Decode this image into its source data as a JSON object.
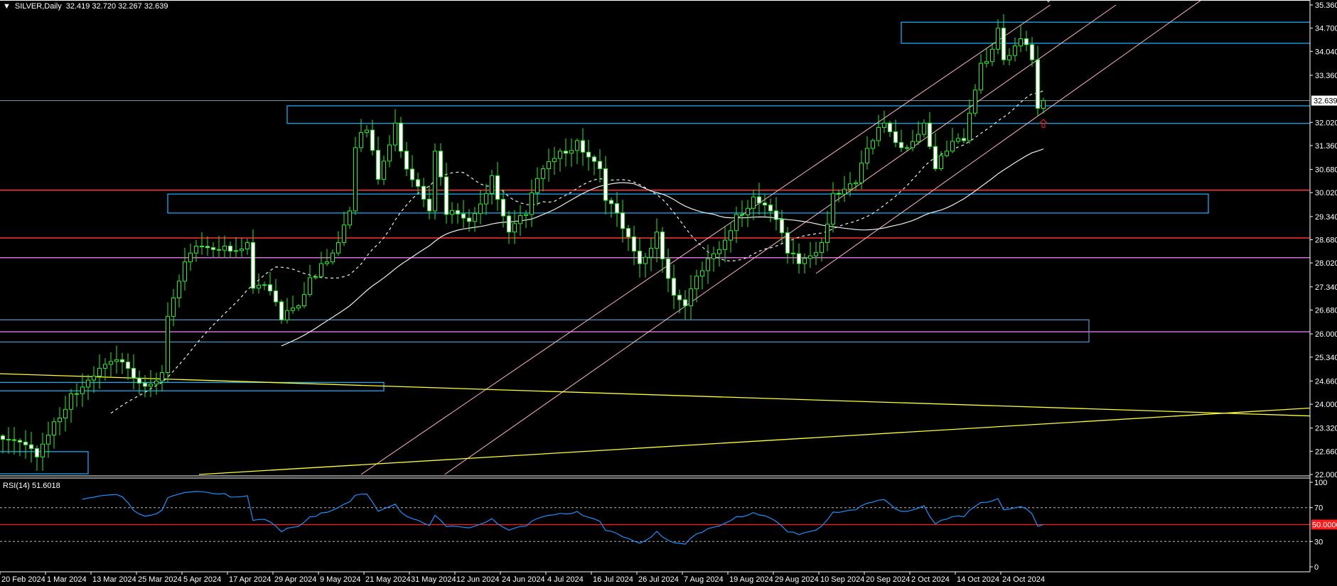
{
  "header": {
    "symbol": "SILVER,Daily",
    "ohlc": "32.419 32.720 32.267 32.639",
    "menu_icon": "triangle-down-icon"
  },
  "rsi": {
    "label": "RSI(14) 51.6018",
    "current_label": "50.0000",
    "levels": [
      70,
      50,
      30
    ],
    "axis_labels": [
      "100",
      "70",
      "30",
      "0"
    ],
    "line_color": "#1e90ff"
  },
  "colors": {
    "background": "#000000",
    "candle_border": "#22ee22",
    "bull_fill": "#000000",
    "bear_fill": "#ffffff",
    "zone": "#19a9f0",
    "zone_dim": "#4a8fc0",
    "red_level": "#ff3030",
    "violet_level": "#d070d0",
    "channel": "#ffb6c1",
    "trend": "#ffff33",
    "current_line": "#8899aa"
  },
  "chart_data": {
    "type": "candlestick",
    "title": "SILVER,Daily",
    "ylim": [
      22.0,
      35.36
    ],
    "current_price": "32.639",
    "last_bar": {
      "open": 32.419,
      "high": 32.72,
      "low": 32.267,
      "close": 32.639
    },
    "price_axis_labels": [
      "35.360",
      "34.700",
      "34.040",
      "33.360",
      "32.020",
      "31.360",
      "30.680",
      "30.020",
      "29.340",
      "28.680",
      "28.020",
      "27.340",
      "26.680",
      "26.000",
      "25.340",
      "24.660",
      "24.000",
      "23.320",
      "22.660",
      "22.000"
    ],
    "date_ticks": [
      {
        "bar": 0,
        "label": "20 Feb 2024"
      },
      {
        "bar": 8,
        "label": "1 Mar 2024"
      },
      {
        "bar": 16,
        "label": "13 Mar 2024"
      },
      {
        "bar": 24,
        "label": "25 Mar 2024"
      },
      {
        "bar": 32,
        "label": "5 Apr 2024"
      },
      {
        "bar": 40,
        "label": "17 Apr 2024"
      },
      {
        "bar": 48,
        "label": "29 Apr 2024"
      },
      {
        "bar": 56,
        "label": "9 May 2024"
      },
      {
        "bar": 64,
        "label": "21 May 2024"
      },
      {
        "bar": 72,
        "label": "31 May 2024"
      },
      {
        "bar": 80,
        "label": "12 Jun 2024"
      },
      {
        "bar": 88,
        "label": "24 Jun 2024"
      },
      {
        "bar": 96,
        "label": "4 Jul 2024"
      },
      {
        "bar": 104,
        "label": "16 Jul 2024"
      },
      {
        "bar": 112,
        "label": "26 Jul 2024"
      },
      {
        "bar": 120,
        "label": "7 Aug 2024"
      },
      {
        "bar": 128,
        "label": "19 Aug 2024"
      },
      {
        "bar": 136,
        "label": "29 Aug 2024"
      },
      {
        "bar": 144,
        "label": "10 Sep 2024"
      },
      {
        "bar": 152,
        "label": "20 Sep 2024"
      },
      {
        "bar": 160,
        "label": "2 Oct 2024"
      },
      {
        "bar": 168,
        "label": "14 Oct 2024"
      },
      {
        "bar": 176,
        "label": "24 Oct 2024"
      }
    ],
    "close_keypoints": [
      [
        0,
        23.0
      ],
      [
        6,
        22.5
      ],
      [
        9,
        23.5
      ],
      [
        12,
        24.3
      ],
      [
        16,
        24.8
      ],
      [
        21,
        25.2
      ],
      [
        24,
        24.6
      ],
      [
        28,
        24.9
      ],
      [
        29,
        26.5
      ],
      [
        31,
        27.5
      ],
      [
        33,
        28.3
      ],
      [
        37,
        28.4
      ],
      [
        39,
        28.5
      ],
      [
        43,
        28.6
      ],
      [
        44,
        27.3
      ],
      [
        46,
        27.4
      ],
      [
        49,
        26.4
      ],
      [
        52,
        26.8
      ],
      [
        54,
        27.6
      ],
      [
        56,
        28.0
      ],
      [
        59,
        28.6
      ],
      [
        61,
        29.5
      ],
      [
        62,
        31.3
      ],
      [
        64,
        31.8
      ],
      [
        66,
        30.4
      ],
      [
        69,
        32.0
      ],
      [
        70,
        31.2
      ],
      [
        73,
        30.2
      ],
      [
        75,
        29.5
      ],
      [
        76,
        31.2
      ],
      [
        78,
        29.4
      ],
      [
        82,
        29.2
      ],
      [
        86,
        30.5
      ],
      [
        89,
        28.9
      ],
      [
        92,
        29.4
      ],
      [
        95,
        30.7
      ],
      [
        98,
        31.2
      ],
      [
        101,
        31.5
      ],
      [
        105,
        30.7
      ],
      [
        106,
        29.8
      ],
      [
        109,
        29.0
      ],
      [
        112,
        28.0
      ],
      [
        115,
        28.9
      ],
      [
        118,
        27.1
      ],
      [
        120,
        26.8
      ],
      [
        123,
        27.8
      ],
      [
        126,
        28.4
      ],
      [
        129,
        29.4
      ],
      [
        132,
        29.9
      ],
      [
        135,
        29.5
      ],
      [
        138,
        28.3
      ],
      [
        140,
        28.0
      ],
      [
        144,
        28.6
      ],
      [
        146,
        30.0
      ],
      [
        150,
        30.3
      ],
      [
        153,
        31.5
      ],
      [
        155,
        32.0
      ],
      [
        158,
        31.3
      ],
      [
        162,
        32.0
      ],
      [
        164,
        30.7
      ],
      [
        166,
        31.2
      ],
      [
        169,
        31.5
      ],
      [
        172,
        33.7
      ],
      [
        174,
        34.1
      ],
      [
        175,
        34.7
      ],
      [
        176,
        33.8
      ],
      [
        179,
        34.4
      ],
      [
        181,
        33.8
      ],
      [
        182,
        32.42
      ],
      [
        183,
        32.639
      ]
    ],
    "moving_averages": [
      {
        "period": 20,
        "style": "dashed"
      },
      {
        "period": 50,
        "style": "solid"
      }
    ],
    "horizontal_levels": [
      {
        "price": 30.09,
        "color": "red"
      },
      {
        "price": 28.73,
        "color": "red"
      },
      {
        "price": 28.17,
        "color": "violet"
      },
      {
        "price": 26.06,
        "color": "violet"
      }
    ],
    "zones": [
      {
        "from_bar": 158,
        "to_bar": 231,
        "top": 34.87,
        "bottom": 34.27,
        "color": "zone"
      },
      {
        "from_bar": 50,
        "to_bar": 231,
        "top": 32.49,
        "bottom": 31.99,
        "color": "zone"
      },
      {
        "from_bar": 29,
        "to_bar": 212,
        "top": 29.98,
        "bottom": 29.44,
        "color": "zone"
      },
      {
        "from_bar": -1,
        "to_bar": 191,
        "top": 26.4,
        "bottom": 25.77,
        "color": "zone_dim"
      },
      {
        "from_bar": -1,
        "to_bar": 67,
        "top": 24.62,
        "bottom": 24.38,
        "color": "zone"
      },
      {
        "from_bar": -1,
        "to_bar": 15,
        "top": 22.65,
        "bottom": 22.02,
        "color": "zone"
      }
    ],
    "channel_lines": [
      {
        "b1": 63,
        "p1": 22.0,
        "b2": 184.2,
        "p2": 35.36
      },
      {
        "b1": 77.7,
        "p1": 22.0,
        "b2": 195.75,
        "p2": 35.36
      },
      {
        "b1": 143,
        "p1": 27.72,
        "b2": 210.75,
        "p2": 35.5
      }
    ],
    "trend_lines": [
      {
        "b1": -1,
        "p1": 24.87,
        "b2": 235,
        "p2": 23.64
      },
      {
        "b1": 34.5,
        "p1": 22.0,
        "b2": 235,
        "p2": 23.94
      }
    ],
    "arrow_marker": {
      "bar": 183,
      "price": 31.98
    }
  }
}
